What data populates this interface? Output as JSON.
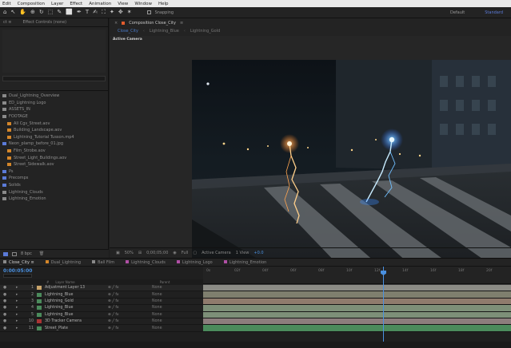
{
  "menubar": {
    "items": [
      "Edit",
      "Composition",
      "Layer",
      "Effect",
      "Animation",
      "View",
      "Window",
      "Help"
    ]
  },
  "toolbar": {
    "tools": [
      "⌂",
      "↖",
      "✋",
      "⊕",
      "↻",
      "⬚",
      "✎",
      "⬜",
      "✒",
      "T",
      "✍",
      "⛶",
      "✦",
      "✥",
      "✶"
    ],
    "snapping_label": "Snapping",
    "workspaces": [
      "Default",
      "Standard"
    ],
    "active_workspace": "Standard"
  },
  "project": {
    "tab_label": "ct ≡",
    "effects_tab": "Effect Controls (none)",
    "files": [
      {
        "name": "Dual_Lightning_Overview",
        "color": "#8a8a8a",
        "icon": "comp"
      },
      {
        "name": "ED_Lightning Logo",
        "color": "#8a8a8a",
        "icon": "comp"
      },
      {
        "name": "ASSETS_IN",
        "color": "#8a8a8a",
        "icon": "folder"
      },
      {
        "name": "FOOTAGE",
        "color": "#8a8a8a",
        "icon": "folder"
      },
      {
        "name": "All Cgs_Street.aov",
        "color": "#d4862a",
        "icon": "footage"
      },
      {
        "name": "Building_Landscape.aov",
        "color": "#d4862a",
        "icon": "footage"
      },
      {
        "name": "Lightning_Tutorial Tusson.mp4",
        "color": "#d4862a",
        "icon": "footage"
      },
      {
        "name": "Neon_plamp_before_01.jpg",
        "color": "#5b7bd8",
        "icon": "image"
      },
      {
        "name": "Film_Strobe.aov",
        "color": "#d4862a",
        "icon": "footage"
      },
      {
        "name": "Street_Light_Buildings.aov",
        "color": "#d4862a",
        "icon": "footage"
      },
      {
        "name": "Street_Sidewalk.aov",
        "color": "#d4862a",
        "icon": "footage"
      },
      {
        "name": "Ps",
        "color": "#5b7bd8",
        "icon": "folder"
      },
      {
        "name": "Precomps",
        "color": "#5b7bd8",
        "icon": "folder"
      },
      {
        "name": "Solids",
        "color": "#5b7bd8",
        "icon": "folder"
      },
      {
        "name": "Lightning_Clouds",
        "color": "#8a8a8a",
        "icon": "comp"
      },
      {
        "name": "Lightning_Emotion",
        "color": "#8a8a8a",
        "icon": "comp"
      }
    ],
    "bpc_label": "8 bpc"
  },
  "composition": {
    "tab_label": "Composition Close_City",
    "subtabs": [
      "Close_City",
      "Lightning_Blue",
      "Lightning_Gold"
    ],
    "active_subtab": "Close_City",
    "camera_label": "Active Camera",
    "footer": {
      "zoom": "50%",
      "timecode": "0;00;05;00",
      "resolution": "Full",
      "camera_select": "Active Camera",
      "view_select": "1 View",
      "extra": "+0.0"
    }
  },
  "timeline": {
    "tabs": [
      {
        "label": "Close_City ≡",
        "color": "#8a8a8a",
        "active": true
      },
      {
        "label": "Dual_Lightning",
        "color": "#d4862a",
        "active": false
      },
      {
        "label": "Ball Film",
        "color": "#8a8a8a",
        "active": false
      },
      {
        "label": "Lightning_Clouds",
        "color": "#b04fa5",
        "active": false
      },
      {
        "label": "Lightning_Logo",
        "color": "#b04fa5",
        "active": false
      },
      {
        "label": "Lightning_Emotion",
        "color": "#b04fa5",
        "active": false
      }
    ],
    "timecode": "0:00:05:00",
    "columns": [
      "#",
      "Layer Name",
      "Parent"
    ],
    "layers": [
      {
        "num": "1",
        "name": "Adjustment Layer 13",
        "chip": "#c9a46a",
        "parent": "None"
      },
      {
        "num": "2",
        "name": "Lightning_Blue",
        "chip": "#4b8b5c",
        "parent": "None"
      },
      {
        "num": "3",
        "name": "Lightning_Gold",
        "chip": "#4b8b5c",
        "parent": "None"
      },
      {
        "num": "4",
        "name": "Lightning_Blue",
        "chip": "#4b8b5c",
        "parent": "None"
      },
      {
        "num": "5",
        "name": "Lightning_Blue",
        "chip": "#4b8b5c",
        "parent": "None"
      },
      {
        "num": "10",
        "name": "3D Tracker Camera",
        "chip": "#a33",
        "parent": "None"
      },
      {
        "num": "11",
        "name": "Street_Plate",
        "chip": "#4b8b5c",
        "parent": "None"
      }
    ],
    "layer_bar_colors": [
      "#8c8c86",
      "#7f7f6e",
      "#8f7b6d",
      "#7d8f78",
      "#7d8f78",
      "#8c7d7d",
      "#4b8b5c"
    ],
    "ruler_ticks": [
      "0s",
      "02f",
      "04f",
      "06f",
      "08f",
      "10f",
      "12f",
      "14f",
      "16f",
      "18f",
      "20f"
    ]
  },
  "colors": {
    "accent": "#4a90e0",
    "orange": "#d4862a"
  }
}
